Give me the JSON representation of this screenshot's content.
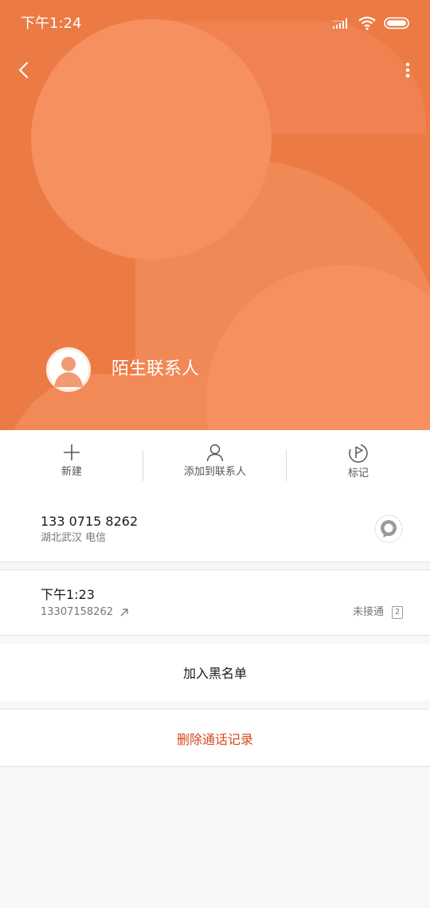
{
  "status_bar": {
    "time": "下午1:24",
    "icons": [
      "signal-icon",
      "wifi-icon",
      "battery-icon"
    ]
  },
  "header": {
    "contact_name": "陌生联系人",
    "back_icon": "chevron-left-icon",
    "more_icon": "more-vertical-icon",
    "avatar_icon": "person-silhouette-icon"
  },
  "actions": [
    {
      "label": "新建",
      "icon": "plus-icon"
    },
    {
      "label": "添加到联系人",
      "icon": "person-icon"
    },
    {
      "label": "标记",
      "icon": "flag-icon"
    }
  ],
  "number_card": {
    "number": "133 0715 8262",
    "location": "湖北武汉 电信",
    "message_icon": "message-bubble-icon"
  },
  "call_log": {
    "time": "下午1:23",
    "number": "13307158262",
    "direction_icon": "outgoing-arrow-icon",
    "status": "未接通",
    "sim": "2"
  },
  "block_label": "加入黑名单",
  "delete_label": "删除通话记录",
  "colors": {
    "header_bg": "#ec7a44",
    "accent_red": "#d4491c",
    "page_bg": "#f7f7f7"
  }
}
